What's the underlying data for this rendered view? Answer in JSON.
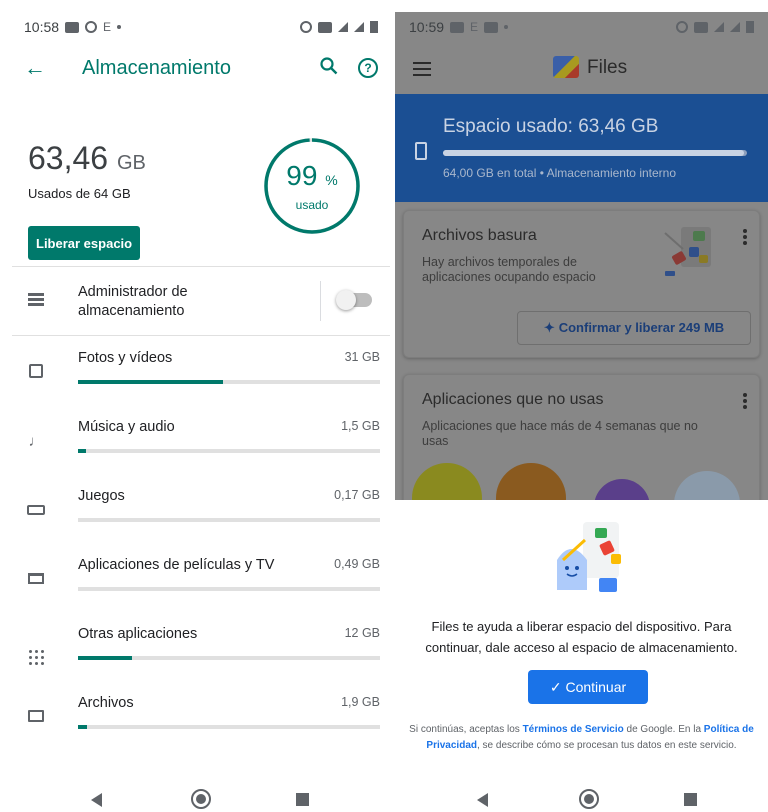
{
  "left": {
    "status": {
      "time": "10:58",
      "letter": "E"
    },
    "appbar": {
      "title": "Almacenamiento",
      "back_icon": "arrow-left-icon",
      "search_icon": "search-icon",
      "help_icon": "help-icon"
    },
    "summary": {
      "used_value": "63,46",
      "used_unit": "GB",
      "used_of": "Usados de 64 GB",
      "free_button": "Liberar espacio",
      "gauge_value": "99",
      "gauge_symbol": "%",
      "gauge_label": "usado",
      "gauge_fraction": 0.99
    },
    "manager": {
      "label": "Administrador de almacenamiento",
      "enabled": false
    },
    "categories": [
      {
        "name": "Fotos y vídeos",
        "size": "31 GB",
        "fraction": 0.48
      },
      {
        "name": "Música y audio",
        "size": "1,5 GB",
        "fraction": 0.025
      },
      {
        "name": "Juegos",
        "size": "0,17 GB",
        "fraction": 0.0
      },
      {
        "name": "Aplicaciones de películas y TV",
        "size": "0,49 GB",
        "fraction": 0.0
      },
      {
        "name": "Otras aplicaciones",
        "size": "12 GB",
        "fraction": 0.18
      },
      {
        "name": "Archivos",
        "size": "1,9 GB",
        "fraction": 0.03
      }
    ]
  },
  "right": {
    "status": {
      "time": "10:59",
      "letter": "E"
    },
    "appbar": {
      "title": "Files"
    },
    "usage": {
      "title": "Espacio usado: 63,46 GB",
      "subtitle": "64,00 GB en total • Almacenamiento interno",
      "fraction": 0.99
    },
    "junk_card": {
      "title": "Archivos basura",
      "subtitle": "Hay archivos temporales de aplicaciones ocupando espacio",
      "button": "Confirmar y liberar 249 MB"
    },
    "unused_card": {
      "title": "Aplicaciones que no usas",
      "subtitle": "Aplicaciones que hace más de 4 semanas que no usas"
    },
    "sheet": {
      "message": "Files te ayuda a liberar espacio del dispositivo. Para continuar, dale acceso al espacio de almacenamiento.",
      "button": "Continuar",
      "legal_1": "Si continúas, aceptas los ",
      "legal_terms": "Términos de Servicio",
      "legal_2": " de Google. En la ",
      "legal_privacy": "Política de Privacidad",
      "legal_3": ", se describe cómo se procesan tus datos en este servicio."
    }
  },
  "colors": {
    "accent_left": "#00796b",
    "accent_right": "#1a73e8",
    "band": "#1b4f93"
  }
}
